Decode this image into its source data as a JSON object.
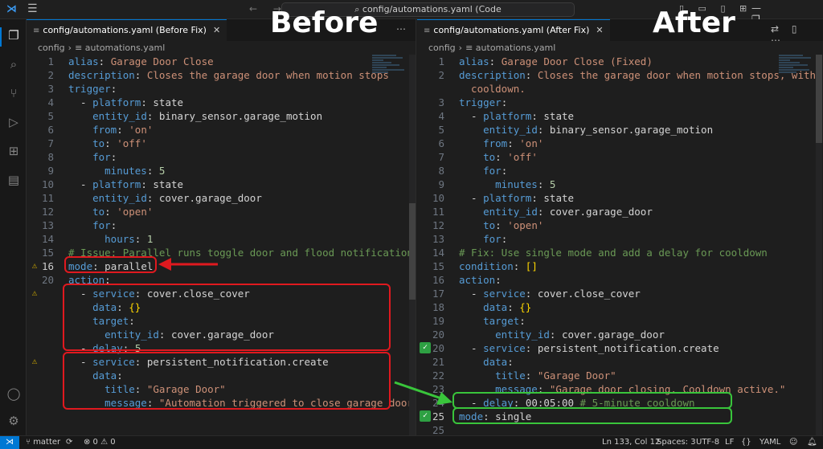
{
  "titlebar": {
    "search_text": "config/automations.yaml (Code",
    "menu_icon": "hamburger-menu-icon",
    "nav_icons": "← →",
    "layout_icons": "▯ ▭ ▯ ⊞",
    "window_controls": "— ❐ ✕"
  },
  "activity_bar": {
    "icons": [
      "explorer-icon",
      "search-icon",
      "source-control-icon",
      "run-debug-icon",
      "extensions-icon",
      "docker-icon",
      "account-icon",
      "settings-gear-icon"
    ]
  },
  "labels": {
    "before": "Before",
    "after": "After"
  },
  "left": {
    "tab_title": "config/automations.yaml (Before Fix)",
    "breadcrumb": [
      "config",
      "automations.yaml"
    ],
    "lines": [
      {
        "n": "1",
        "g": "",
        "tokens": [
          [
            "k",
            "alias"
          ],
          [
            "p",
            ": "
          ],
          [
            "s",
            "Garage Door Close"
          ]
        ]
      },
      {
        "n": "2",
        "g": "",
        "tokens": [
          [
            "k",
            "description"
          ],
          [
            "p",
            ": "
          ],
          [
            "s",
            "Closes the garage door when motion stops"
          ]
        ]
      },
      {
        "n": "3",
        "g": "",
        "tokens": [
          [
            "k",
            "trigger"
          ],
          [
            "p",
            ":"
          ]
        ]
      },
      {
        "n": "4",
        "g": "",
        "tokens": [
          [
            "p",
            "  - "
          ],
          [
            "k",
            "platform"
          ],
          [
            "p",
            ": "
          ],
          [
            "p",
            "state"
          ]
        ]
      },
      {
        "n": "5",
        "g": "",
        "tokens": [
          [
            "p",
            "    "
          ],
          [
            "k",
            "entity_id"
          ],
          [
            "p",
            ": "
          ],
          [
            "p",
            "binary_sensor.garage_motion"
          ]
        ]
      },
      {
        "n": "6",
        "g": "",
        "tokens": [
          [
            "p",
            "    "
          ],
          [
            "k",
            "from"
          ],
          [
            "p",
            ": "
          ],
          [
            "s",
            "'on'"
          ]
        ]
      },
      {
        "n": "7",
        "g": "",
        "tokens": [
          [
            "p",
            "    "
          ],
          [
            "k",
            "to"
          ],
          [
            "p",
            ": "
          ],
          [
            "s",
            "'off'"
          ]
        ]
      },
      {
        "n": "8",
        "g": "",
        "tokens": [
          [
            "p",
            "    "
          ],
          [
            "k",
            "for"
          ],
          [
            "p",
            ":"
          ]
        ]
      },
      {
        "n": "9",
        "g": "",
        "tokens": [
          [
            "p",
            "      "
          ],
          [
            "k",
            "minutes"
          ],
          [
            "p",
            ": "
          ],
          [
            "n",
            "5"
          ]
        ]
      },
      {
        "n": "10",
        "g": "",
        "tokens": [
          [
            "p",
            "  - "
          ],
          [
            "k",
            "platform"
          ],
          [
            "p",
            ": "
          ],
          [
            "p",
            "state"
          ]
        ]
      },
      {
        "n": "11",
        "g": "",
        "tokens": [
          [
            "p",
            "    "
          ],
          [
            "k",
            "entity_id"
          ],
          [
            "p",
            ": "
          ],
          [
            "p",
            "cover.garage_door"
          ]
        ]
      },
      {
        "n": "12",
        "g": "",
        "tokens": [
          [
            "p",
            "    "
          ],
          [
            "k",
            "to"
          ],
          [
            "p",
            ": "
          ],
          [
            "s",
            "'open'"
          ]
        ]
      },
      {
        "n": "13",
        "g": "",
        "tokens": [
          [
            "p",
            "    "
          ],
          [
            "k",
            "for"
          ],
          [
            "p",
            ":"
          ]
        ]
      },
      {
        "n": "14",
        "g": "",
        "tokens": [
          [
            "p",
            "      "
          ],
          [
            "k",
            "hours"
          ],
          [
            "p",
            ": "
          ],
          [
            "n",
            "1"
          ]
        ]
      },
      {
        "n": "15",
        "g": "",
        "tokens": [
          [
            "c",
            "# Issue: Parallel runs toggle door and flood notifications"
          ]
        ]
      },
      {
        "n": "16",
        "g": "warn",
        "cur": true,
        "tokens": [
          [
            "k",
            "mode"
          ],
          [
            "p",
            ": "
          ],
          [
            "p",
            "parallel"
          ]
        ]
      },
      {
        "n": "20",
        "g": "",
        "tokens": [
          [
            "k",
            "action"
          ],
          [
            "p",
            ":"
          ]
        ]
      },
      {
        "n": "",
        "g": "warn",
        "tokens": [
          [
            "p",
            "  - "
          ],
          [
            "k",
            "service"
          ],
          [
            "p",
            ": "
          ],
          [
            "p",
            "cover.close_cover"
          ]
        ]
      },
      {
        "n": "",
        "g": "",
        "tokens": [
          [
            "p",
            "    "
          ],
          [
            "k",
            "data"
          ],
          [
            "p",
            ": "
          ],
          [
            "y",
            "{}"
          ]
        ]
      },
      {
        "n": "",
        "g": "",
        "tokens": [
          [
            "p",
            "    "
          ],
          [
            "k",
            "target"
          ],
          [
            "p",
            ":"
          ]
        ]
      },
      {
        "n": "",
        "g": "",
        "tokens": [
          [
            "p",
            "      "
          ],
          [
            "k",
            "entity_id"
          ],
          [
            "p",
            ": "
          ],
          [
            "p",
            "cover.garage_door"
          ]
        ]
      },
      {
        "n": "",
        "g": "",
        "tokens": [
          [
            "p",
            "  - "
          ],
          [
            "k",
            "delay"
          ],
          [
            "p",
            ": "
          ],
          [
            "n",
            "5"
          ]
        ]
      },
      {
        "n": "",
        "g": "warn",
        "tokens": [
          [
            "p",
            "  - "
          ],
          [
            "k",
            "service"
          ],
          [
            "p",
            ": "
          ],
          [
            "p",
            "persistent_notification.create"
          ]
        ]
      },
      {
        "n": "",
        "g": "",
        "tokens": [
          [
            "p",
            "    "
          ],
          [
            "k",
            "data"
          ],
          [
            "p",
            ":"
          ]
        ]
      },
      {
        "n": "",
        "g": "",
        "tokens": [
          [
            "p",
            "      "
          ],
          [
            "k",
            "title"
          ],
          [
            "p",
            ": "
          ],
          [
            "s",
            "\"Garage Door\""
          ]
        ]
      },
      {
        "n": "",
        "g": "",
        "tokens": [
          [
            "p",
            "      "
          ],
          [
            "k",
            "message"
          ],
          [
            "p",
            ": "
          ],
          [
            "s",
            "\"Automation triggered to close garage door.\""
          ]
        ]
      }
    ]
  },
  "right": {
    "tab_title": "config/automations.yaml (After Fix)",
    "breadcrumb": [
      "config",
      "automations.yaml"
    ],
    "tab_actions": "⇄ ▯ ⋯",
    "lines": [
      {
        "n": "1",
        "g": "",
        "tokens": [
          [
            "k",
            "alias"
          ],
          [
            "p",
            ": "
          ],
          [
            "s",
            "Garage Door Close (Fixed)"
          ]
        ]
      },
      {
        "n": "2",
        "g": "",
        "tokens": [
          [
            "k",
            "description"
          ],
          [
            "p",
            ": "
          ],
          [
            "s",
            "Closes the garage door when motion stops, with"
          ]
        ]
      },
      {
        "n": "",
        "g": "",
        "tokens": [
          [
            "s",
            "  cooldown."
          ]
        ]
      },
      {
        "n": "3",
        "g": "",
        "tokens": [
          [
            "k",
            "trigger"
          ],
          [
            "p",
            ":"
          ]
        ]
      },
      {
        "n": "4",
        "g": "",
        "tokens": [
          [
            "p",
            "  - "
          ],
          [
            "k",
            "platform"
          ],
          [
            "p",
            ": "
          ],
          [
            "p",
            "state"
          ]
        ]
      },
      {
        "n": "5",
        "g": "",
        "tokens": [
          [
            "p",
            "    "
          ],
          [
            "k",
            "entity_id"
          ],
          [
            "p",
            ": "
          ],
          [
            "p",
            "binary_sensor.garage_motion"
          ]
        ]
      },
      {
        "n": "6",
        "g": "",
        "tokens": [
          [
            "p",
            "    "
          ],
          [
            "k",
            "from"
          ],
          [
            "p",
            ": "
          ],
          [
            "s",
            "'on'"
          ]
        ]
      },
      {
        "n": "7",
        "g": "",
        "tokens": [
          [
            "p",
            "    "
          ],
          [
            "k",
            "to"
          ],
          [
            "p",
            ": "
          ],
          [
            "s",
            "'off'"
          ]
        ]
      },
      {
        "n": "8",
        "g": "",
        "tokens": [
          [
            "p",
            "    "
          ],
          [
            "k",
            "for"
          ],
          [
            "p",
            ":"
          ]
        ]
      },
      {
        "n": "9",
        "g": "",
        "tokens": [
          [
            "p",
            "      "
          ],
          [
            "k",
            "minutes"
          ],
          [
            "p",
            ": "
          ],
          [
            "n",
            "5"
          ]
        ]
      },
      {
        "n": "10",
        "g": "",
        "tokens": [
          [
            "p",
            "  - "
          ],
          [
            "k",
            "platform"
          ],
          [
            "p",
            ": "
          ],
          [
            "p",
            "state"
          ]
        ]
      },
      {
        "n": "11",
        "g": "",
        "tokens": [
          [
            "p",
            "    "
          ],
          [
            "k",
            "entity_id"
          ],
          [
            "p",
            ": "
          ],
          [
            "p",
            "cover.garage_door"
          ]
        ]
      },
      {
        "n": "12",
        "g": "",
        "tokens": [
          [
            "p",
            "    "
          ],
          [
            "k",
            "to"
          ],
          [
            "p",
            ": "
          ],
          [
            "s",
            "'open'"
          ]
        ]
      },
      {
        "n": "13",
        "g": "",
        "tokens": [
          [
            "p",
            "    "
          ],
          [
            "k",
            "for"
          ],
          [
            "p",
            ":"
          ]
        ]
      },
      {
        "n": "14",
        "g": "",
        "tokens": [
          [
            "c",
            "# Fix: Use single mode and add a delay for cooldown"
          ]
        ]
      },
      {
        "n": "15",
        "g": "",
        "tokens": [
          [
            "k",
            "condition"
          ],
          [
            "p",
            ": "
          ],
          [
            "y",
            "[]"
          ]
        ]
      },
      {
        "n": "16",
        "g": "",
        "tokens": [
          [
            "k",
            "action"
          ],
          [
            "p",
            ":"
          ]
        ]
      },
      {
        "n": "17",
        "g": "",
        "tokens": [
          [
            "p",
            "  - "
          ],
          [
            "k",
            "service"
          ],
          [
            "p",
            ": "
          ],
          [
            "p",
            "cover.close_cover"
          ]
        ]
      },
      {
        "n": "18",
        "g": "",
        "tokens": [
          [
            "p",
            "    "
          ],
          [
            "k",
            "data"
          ],
          [
            "p",
            ": "
          ],
          [
            "y",
            "{}"
          ]
        ]
      },
      {
        "n": "19",
        "g": "",
        "tokens": [
          [
            "p",
            "    "
          ],
          [
            "k",
            "target"
          ],
          [
            "p",
            ":"
          ]
        ]
      },
      {
        "n": "20",
        "g": "",
        "tokens": [
          [
            "p",
            "      "
          ],
          [
            "k",
            "entity_id"
          ],
          [
            "p",
            ": "
          ],
          [
            "p",
            "cover.garage_door"
          ]
        ]
      },
      {
        "n": "20",
        "g": "ok",
        "tokens": [
          [
            "p",
            "  - "
          ],
          [
            "k",
            "service"
          ],
          [
            "p",
            ": "
          ],
          [
            "p",
            "persistent_notification.create"
          ]
        ]
      },
      {
        "n": "21",
        "g": "",
        "tokens": [
          [
            "p",
            "    "
          ],
          [
            "k",
            "data"
          ],
          [
            "p",
            ":"
          ]
        ]
      },
      {
        "n": "22",
        "g": "",
        "tokens": [
          [
            "p",
            "      "
          ],
          [
            "k",
            "title"
          ],
          [
            "p",
            ": "
          ],
          [
            "s",
            "\"Garage Door\""
          ]
        ]
      },
      {
        "n": "23",
        "g": "",
        "tokens": [
          [
            "p",
            "      "
          ],
          [
            "k",
            "message"
          ],
          [
            "p",
            ": "
          ],
          [
            "s",
            "\"Garage door closing. Cooldown active.\""
          ]
        ]
      },
      {
        "n": "24",
        "g": "",
        "tokens": [
          [
            "p",
            "  - "
          ],
          [
            "k",
            "delay"
          ],
          [
            "p",
            ": "
          ],
          [
            "p",
            "00:05:00 "
          ],
          [
            "c",
            "# 5-minute cooldown"
          ]
        ]
      },
      {
        "n": "25",
        "g": "ok",
        "cur": true,
        "tokens": [
          [
            "k",
            "mode"
          ],
          [
            "p",
            ": "
          ],
          [
            "p",
            "single"
          ]
        ]
      },
      {
        "n": "25",
        "g": "",
        "tokens": []
      }
    ]
  },
  "statusbar": {
    "remote_icon": "remote-icon",
    "branch": "matter",
    "sync_icon": "sync-icon",
    "problems": "⊗ 0 ⚠ 0",
    "position": "Ln 133, Col 12",
    "spaces": "Spaces: 3",
    "encoding": "UTF-8",
    "eol": "LF",
    "language": "YAML",
    "colors": {
      "remote_bg": "#0078d4"
    }
  },
  "colors": {
    "annotation_red": "#e0191f",
    "annotation_green": "#39c53b",
    "yaml_key": "#569cd6",
    "yaml_string": "#ce9178",
    "yaml_number": "#b5cea8",
    "yaml_comment": "#6a9955"
  }
}
